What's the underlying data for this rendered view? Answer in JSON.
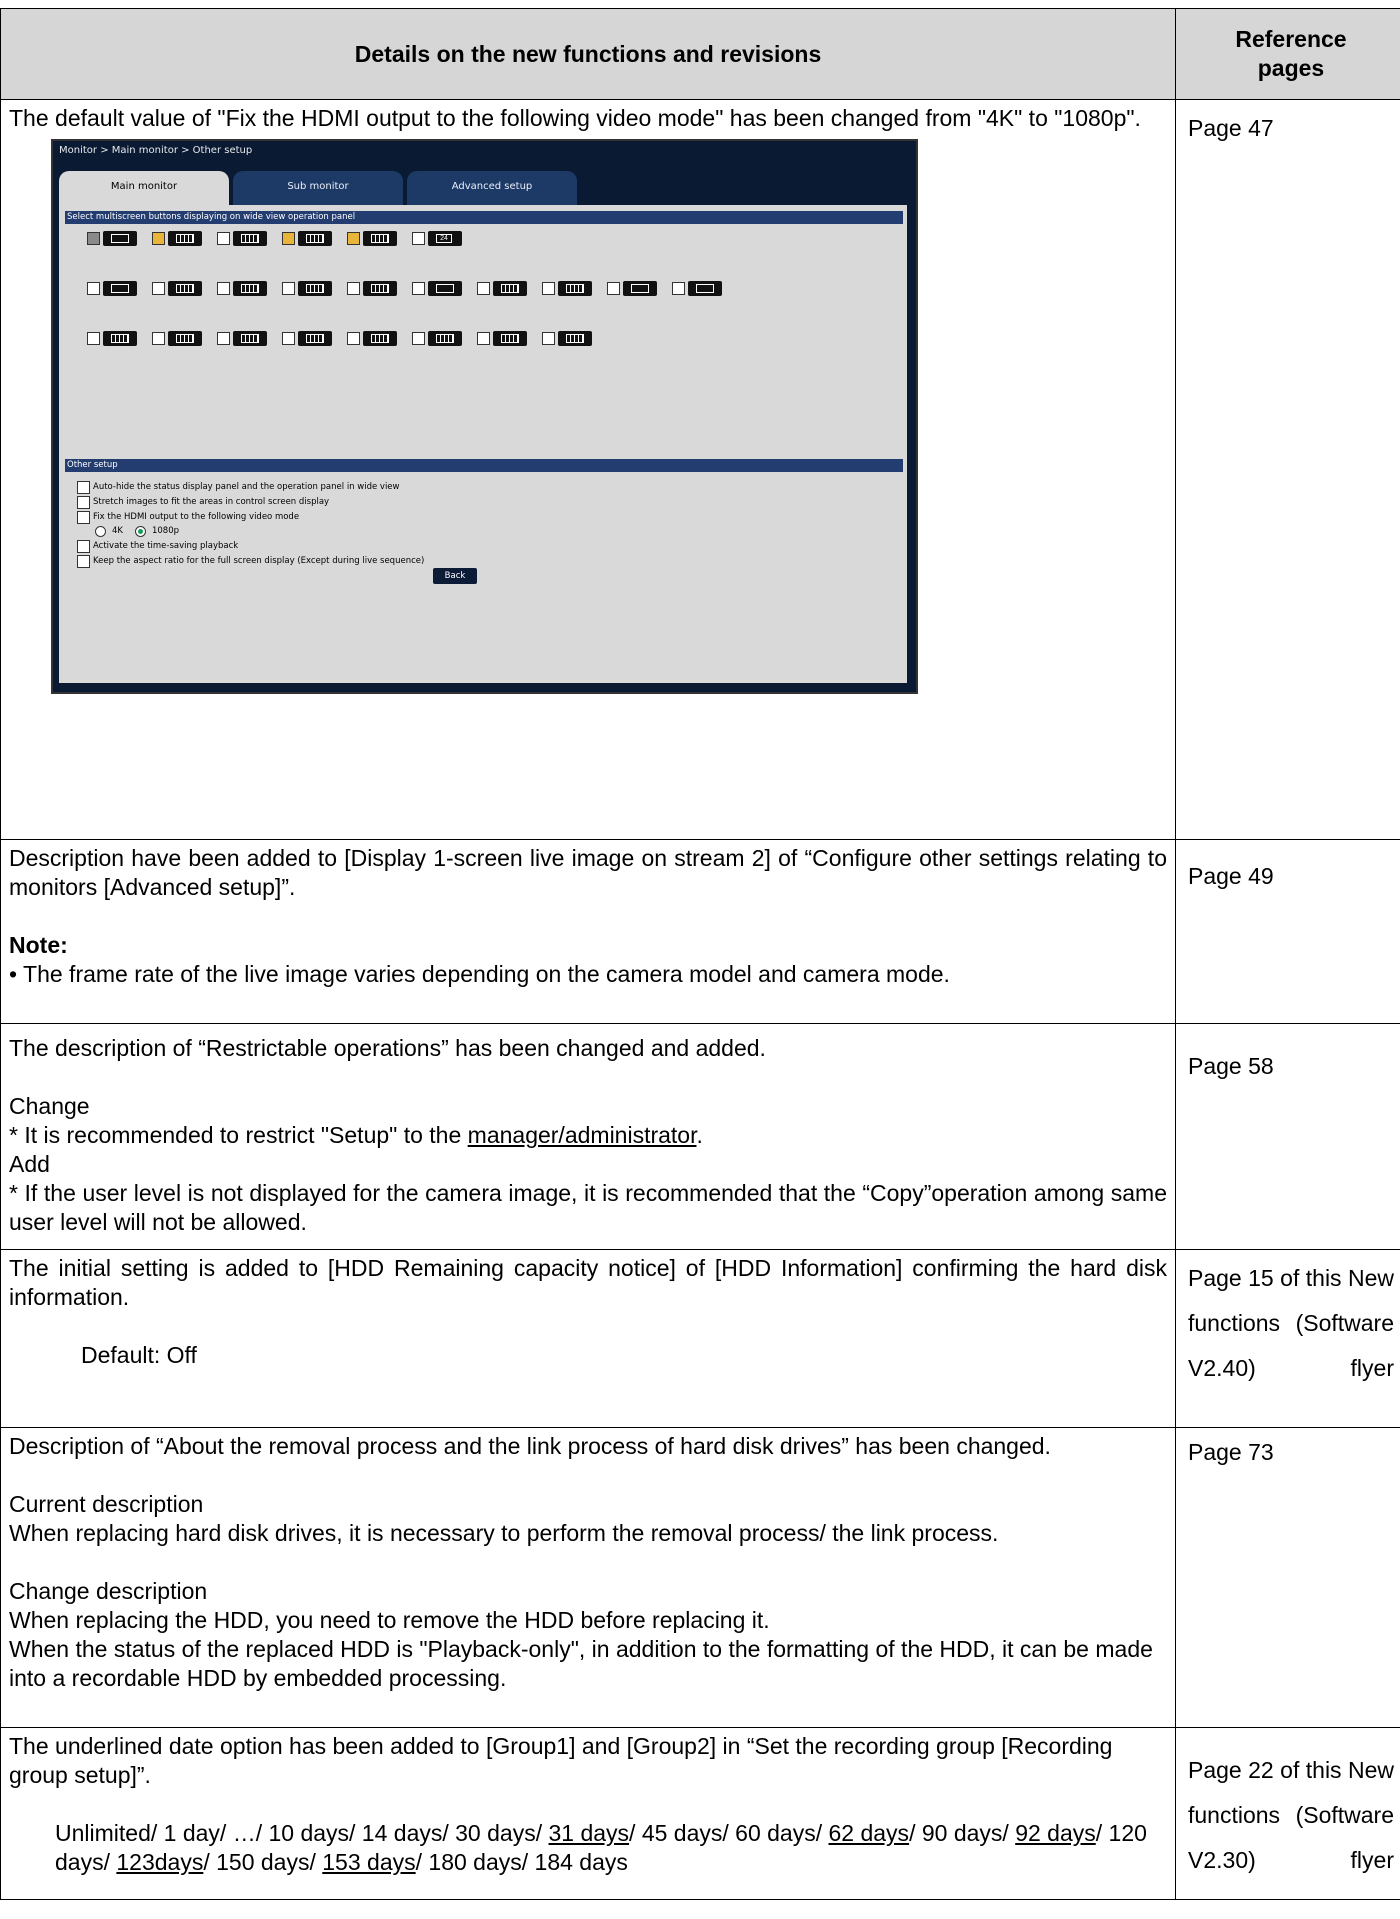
{
  "header": {
    "col1": "Details on the new functions and revisions",
    "col2_line1": "Reference",
    "col2_line2": "pages"
  },
  "rows": [
    {
      "text1": "The default value of \"Fix the HDMI output to the following video mode\" has been changed from \"4K\" to \"1080p\".",
      "ref": "Page 47",
      "screenshot": {
        "breadcrumb": "Monitor > Main monitor > Other setup",
        "tabs": [
          "Main monitor",
          "Sub monitor",
          "Advanced setup"
        ],
        "section1": "Select multiscreen buttons displaying on wide view operation panel",
        "section2": "Other setup",
        "options": [
          "Auto-hide the status display panel and the operation panel in wide view",
          "Stretch images to fit the areas in control screen display",
          "Fix the HDMI output to the following video mode",
          "Activate the time-saving playback",
          "Keep the aspect ratio for the full screen display (Except during live sequence)"
        ],
        "radio_4k": "4K",
        "radio_1080p": "1080p",
        "back_button": "Back",
        "icon_24": "24"
      }
    },
    {
      "text1": "Description have been added to [Display 1-screen live image on stream 2] of “Configure other settings relating to monitors [Advanced setup]”.",
      "note_label": "Note:",
      "note_text": "• The frame rate of the live image varies depending on the camera model and camera mode.",
      "ref": "Page 49"
    },
    {
      "text1": "The description of “Restrictable operations” has been changed and added.",
      "change_label": "Change",
      "change_pre": "* It is recommended to restrict \"Setup\" to the ",
      "change_u": "manager/administrator",
      "change_post": ".",
      "add_label": "Add",
      "add_text": "* If the user level is not displayed for the camera image, it is recommended that the “Copy”operation among same user level will not be allowed.",
      "ref": "Page 58"
    },
    {
      "text1": "The initial setting is added to [HDD Remaining capacity notice] of [HDD Information] confirming the hard disk information.",
      "default": "Default: Off",
      "ref": "Page 15 of this New functions (Software V2.40) flyer"
    },
    {
      "text1": "Description of “About the removal process and the link process of hard disk drives” has been changed.",
      "current_label": "Current description",
      "current_text": "When replacing hard disk drives, it is necessary to perform the removal process/ the link process.",
      "change_label": "Change description",
      "change_text1": "When replacing the HDD, you need to remove the HDD before replacing it.",
      "change_text2": "When the status of the replaced HDD is \"Playback-only\", in addition to the formatting of the HDD, it can be made into a recordable HDD by embedded processing.",
      "ref": "Page 73"
    },
    {
      "text1": "The underlined date option has been added to [Group1] and [Group2] in “Set the recording group [Recording group setup]”.",
      "d1": "Unlimited/ 1 day/ …/ 10 days/ 14 days/ 30 days/ ",
      "d2": "31 days",
      "d3": "/ 45 days/ 60 days/ ",
      "d4": "62 days",
      "d5": "/ 90 days/ ",
      "d6": "92 days",
      "d7": "/ 120 days/ ",
      "d8": "123days",
      "d9": "/ 150 days/ ",
      "d10": "153 days",
      "d11": "/ 180 days/ 184 days",
      "ref": "Page 22 of this New functions (Software V2.30) flyer"
    }
  ]
}
